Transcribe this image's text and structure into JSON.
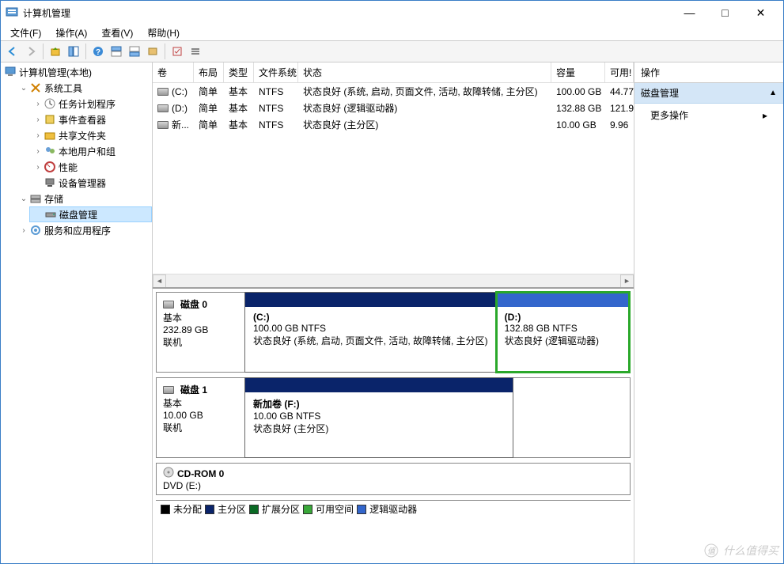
{
  "window": {
    "title": "计算机管理"
  },
  "menu": {
    "file": "文件(F)",
    "action": "操作(A)",
    "view": "查看(V)",
    "help": "帮助(H)"
  },
  "tree": {
    "root": "计算机管理(本地)",
    "system_tools": "系统工具",
    "task_scheduler": "任务计划程序",
    "event_viewer": "事件查看器",
    "shared_folders": "共享文件夹",
    "local_users": "本地用户和组",
    "performance": "性能",
    "device_manager": "设备管理器",
    "storage": "存储",
    "disk_management": "磁盘管理",
    "services_apps": "服务和应用程序"
  },
  "columns": {
    "volume": "卷",
    "layout": "布局",
    "type": "类型",
    "filesystem": "文件系统",
    "status": "状态",
    "capacity": "容量",
    "free": "可用!"
  },
  "volumes": [
    {
      "name": "(C:)",
      "layout": "简单",
      "type": "基本",
      "fs": "NTFS",
      "status": "状态良好 (系统, 启动, 页面文件, 活动, 故障转储, 主分区)",
      "cap": "100.00 GB",
      "free": "44.77"
    },
    {
      "name": "(D:)",
      "layout": "简单",
      "type": "基本",
      "fs": "NTFS",
      "status": "状态良好 (逻辑驱动器)",
      "cap": "132.88 GB",
      "free": "121.9"
    },
    {
      "name": "新...",
      "layout": "简单",
      "type": "基本",
      "fs": "NTFS",
      "status": "状态良好 (主分区)",
      "cap": "10.00 GB",
      "free": "9.96"
    }
  ],
  "disks": {
    "disk0": {
      "name": "磁盘 0",
      "type": "基本",
      "size": "232.89 GB",
      "status": "联机",
      "parts": [
        {
          "title": "(C:)",
          "size": "100.00 GB NTFS",
          "status": "状态良好 (系统, 启动, 页面文件, 活动, 故障转储, 主分区)",
          "bar": "primary"
        },
        {
          "title": "(D:)",
          "size": "132.88 GB NTFS",
          "status": "状态良好 (逻辑驱动器)",
          "bar": "logical",
          "selected": true
        }
      ]
    },
    "disk1": {
      "name": "磁盘 1",
      "type": "基本",
      "size": "10.00 GB",
      "status": "联机",
      "parts": [
        {
          "title": "新加卷  (F:)",
          "size": "10.00 GB NTFS",
          "status": "状态良好 (主分区)",
          "bar": "primary"
        }
      ]
    },
    "cdrom": {
      "name": "CD-ROM 0",
      "line2": "DVD (E:)"
    }
  },
  "legend": {
    "unallocated": "未分配",
    "primary": "主分区",
    "extended": "扩展分区",
    "free": "可用空间",
    "logical": "逻辑驱动器"
  },
  "actions": {
    "header": "操作",
    "disk_mgmt": "磁盘管理",
    "more": "更多操作"
  },
  "watermark": "什么值得买"
}
